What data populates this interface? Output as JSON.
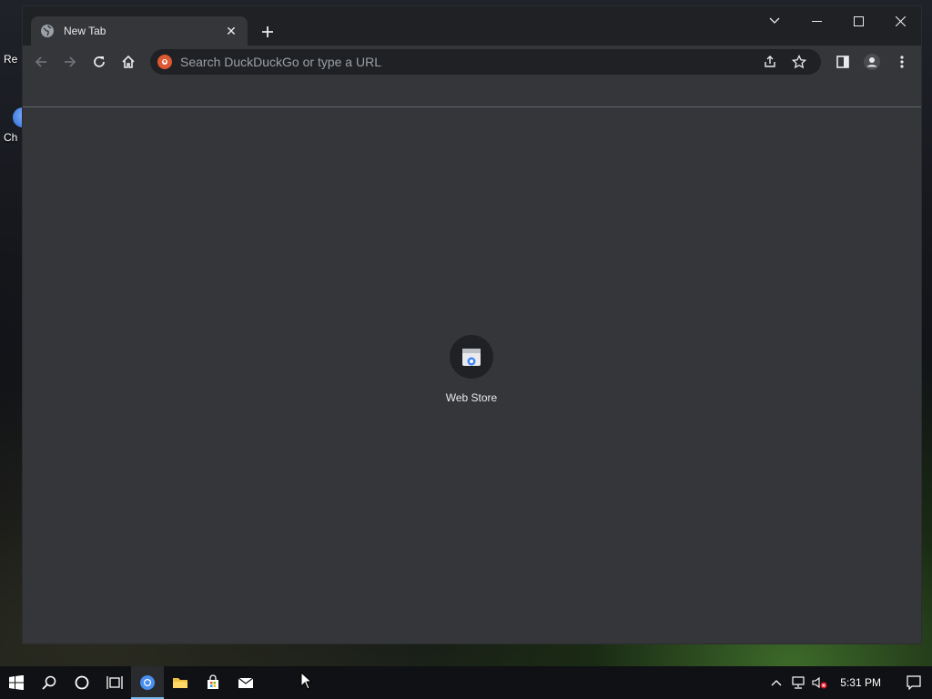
{
  "desktop": {
    "icons": [
      {
        "label": "Re"
      },
      {
        "label": "Ch"
      }
    ]
  },
  "browser": {
    "tab": {
      "title": "New Tab",
      "favicon": "globe-icon"
    },
    "omnibox": {
      "placeholder": "Search DuckDuckGo or type a URL",
      "value": ""
    },
    "shortcuts": [
      {
        "label": "Web Store",
        "icon": "web-store-icon"
      }
    ]
  },
  "taskbar": {
    "clock": "5:31 PM",
    "apps": [
      "start-icon",
      "search-icon",
      "cortana-icon",
      "task-view-icon",
      "chrome-icon",
      "file-explorer-icon",
      "store-icon",
      "mail-icon"
    ]
  },
  "colors": {
    "frame": "#202124",
    "toolbar": "#35363a",
    "accent": "#76b9ed",
    "ddg": "#de5833"
  }
}
